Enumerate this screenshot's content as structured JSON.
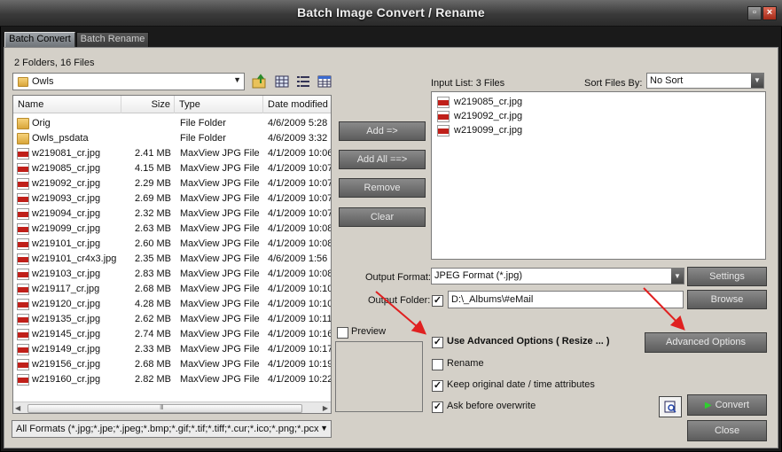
{
  "window": {
    "title": "Batch Image Convert / Rename"
  },
  "tabs": [
    {
      "label": "Batch Convert",
      "active": true
    },
    {
      "label": "Batch Rename",
      "active": false
    }
  ],
  "browser": {
    "summary": "2 Folders, 16 Files",
    "current_folder": "Owls",
    "columns": {
      "name": "Name",
      "size": "Size",
      "type": "Type",
      "date": "Date modified"
    },
    "files": [
      {
        "icon": "folder-icon",
        "name": "Orig",
        "size": "",
        "type": "File Folder",
        "date": "4/6/2009 5:28"
      },
      {
        "icon": "folder-icon",
        "name": "Owls_psdata",
        "size": "",
        "type": "File Folder",
        "date": "4/6/2009 3:32"
      },
      {
        "icon": "jpg-icon",
        "name": "w219081_cr.jpg",
        "size": "2.41 MB",
        "type": "MaxView JPG File",
        "date": "4/1/2009 10:06"
      },
      {
        "icon": "jpg-icon",
        "name": "w219085_cr.jpg",
        "size": "4.15 MB",
        "type": "MaxView JPG File",
        "date": "4/1/2009 10:07"
      },
      {
        "icon": "jpg-icon",
        "name": "w219092_cr.jpg",
        "size": "2.29 MB",
        "type": "MaxView JPG File",
        "date": "4/1/2009 10:07"
      },
      {
        "icon": "jpg-icon",
        "name": "w219093_cr.jpg",
        "size": "2.69 MB",
        "type": "MaxView JPG File",
        "date": "4/1/2009 10:07"
      },
      {
        "icon": "jpg-icon",
        "name": "w219094_cr.jpg",
        "size": "2.32 MB",
        "type": "MaxView JPG File",
        "date": "4/1/2009 10:07"
      },
      {
        "icon": "jpg-icon",
        "name": "w219099_cr.jpg",
        "size": "2.63 MB",
        "type": "MaxView JPG File",
        "date": "4/1/2009 10:08"
      },
      {
        "icon": "jpg-icon",
        "name": "w219101_cr.jpg",
        "size": "2.60 MB",
        "type": "MaxView JPG File",
        "date": "4/1/2009 10:08"
      },
      {
        "icon": "jpg-icon",
        "name": "w219101_cr4x3.jpg",
        "size": "2.35 MB",
        "type": "MaxView JPG File",
        "date": "4/6/2009 1:56"
      },
      {
        "icon": "jpg-icon",
        "name": "w219103_cr.jpg",
        "size": "2.83 MB",
        "type": "MaxView JPG File",
        "date": "4/1/2009 10:08"
      },
      {
        "icon": "jpg-icon",
        "name": "w219117_cr.jpg",
        "size": "2.68 MB",
        "type": "MaxView JPG File",
        "date": "4/1/2009 10:10"
      },
      {
        "icon": "jpg-icon",
        "name": "w219120_cr.jpg",
        "size": "4.28 MB",
        "type": "MaxView JPG File",
        "date": "4/1/2009 10:10"
      },
      {
        "icon": "jpg-icon",
        "name": "w219135_cr.jpg",
        "size": "2.62 MB",
        "type": "MaxView JPG File",
        "date": "4/1/2009 10:11"
      },
      {
        "icon": "jpg-icon",
        "name": "w219145_cr.jpg",
        "size": "2.74 MB",
        "type": "MaxView JPG File",
        "date": "4/1/2009 10:16"
      },
      {
        "icon": "jpg-icon",
        "name": "w219149_cr.jpg",
        "size": "2.33 MB",
        "type": "MaxView JPG File",
        "date": "4/1/2009 10:17"
      },
      {
        "icon": "jpg-icon",
        "name": "w219156_cr.jpg",
        "size": "2.68 MB",
        "type": "MaxView JPG File",
        "date": "4/1/2009 10:19"
      },
      {
        "icon": "jpg-icon",
        "name": "w219160_cr.jpg",
        "size": "2.82 MB",
        "type": "MaxView JPG File",
        "date": "4/1/2009 10:22"
      }
    ],
    "scroll_grip": "III",
    "format_filter": "All Formats (*.jpg;*.jpe;*.jpeg;*.bmp;*.gif;*.tif;*.tiff;*.cur;*.ico;*.png;*.pcx"
  },
  "actions": {
    "add": "Add =>",
    "add_all": "Add All ==>",
    "remove": "Remove",
    "clear": "Clear"
  },
  "input_list": {
    "label": "Input List:  3 Files",
    "sort_label": "Sort Files By:",
    "sort_value": "No Sort",
    "files": [
      "w219085_cr.jpg",
      "w219092_cr.jpg",
      "w219099_cr.jpg"
    ]
  },
  "output": {
    "format_label": "Output Format:",
    "format_value": "JPEG Format (*.jpg)",
    "settings": "Settings",
    "folder_label": "Output Folder:",
    "folder_checked": true,
    "folder_value": "D:\\_Albums\\#eMail",
    "browse": "Browse"
  },
  "preview": {
    "label": "Preview",
    "checked": false
  },
  "options": {
    "advanced": {
      "label": "Use Advanced Options ( Resize ... )",
      "checked": true
    },
    "rename": {
      "label": "Rename",
      "checked": false
    },
    "keep_date": {
      "label": "Keep original date / time attributes",
      "checked": true
    },
    "ask_overwrite": {
      "label": "Ask before overwrite",
      "checked": true
    },
    "advanced_button": "Advanced Options"
  },
  "bottom": {
    "convert": "Convert",
    "close": "Close"
  },
  "colors": {
    "panel": "#d4d0c8",
    "button": "#6a6a6a",
    "annotation_arrow": "#e02020",
    "play": "#2fcf2f"
  }
}
